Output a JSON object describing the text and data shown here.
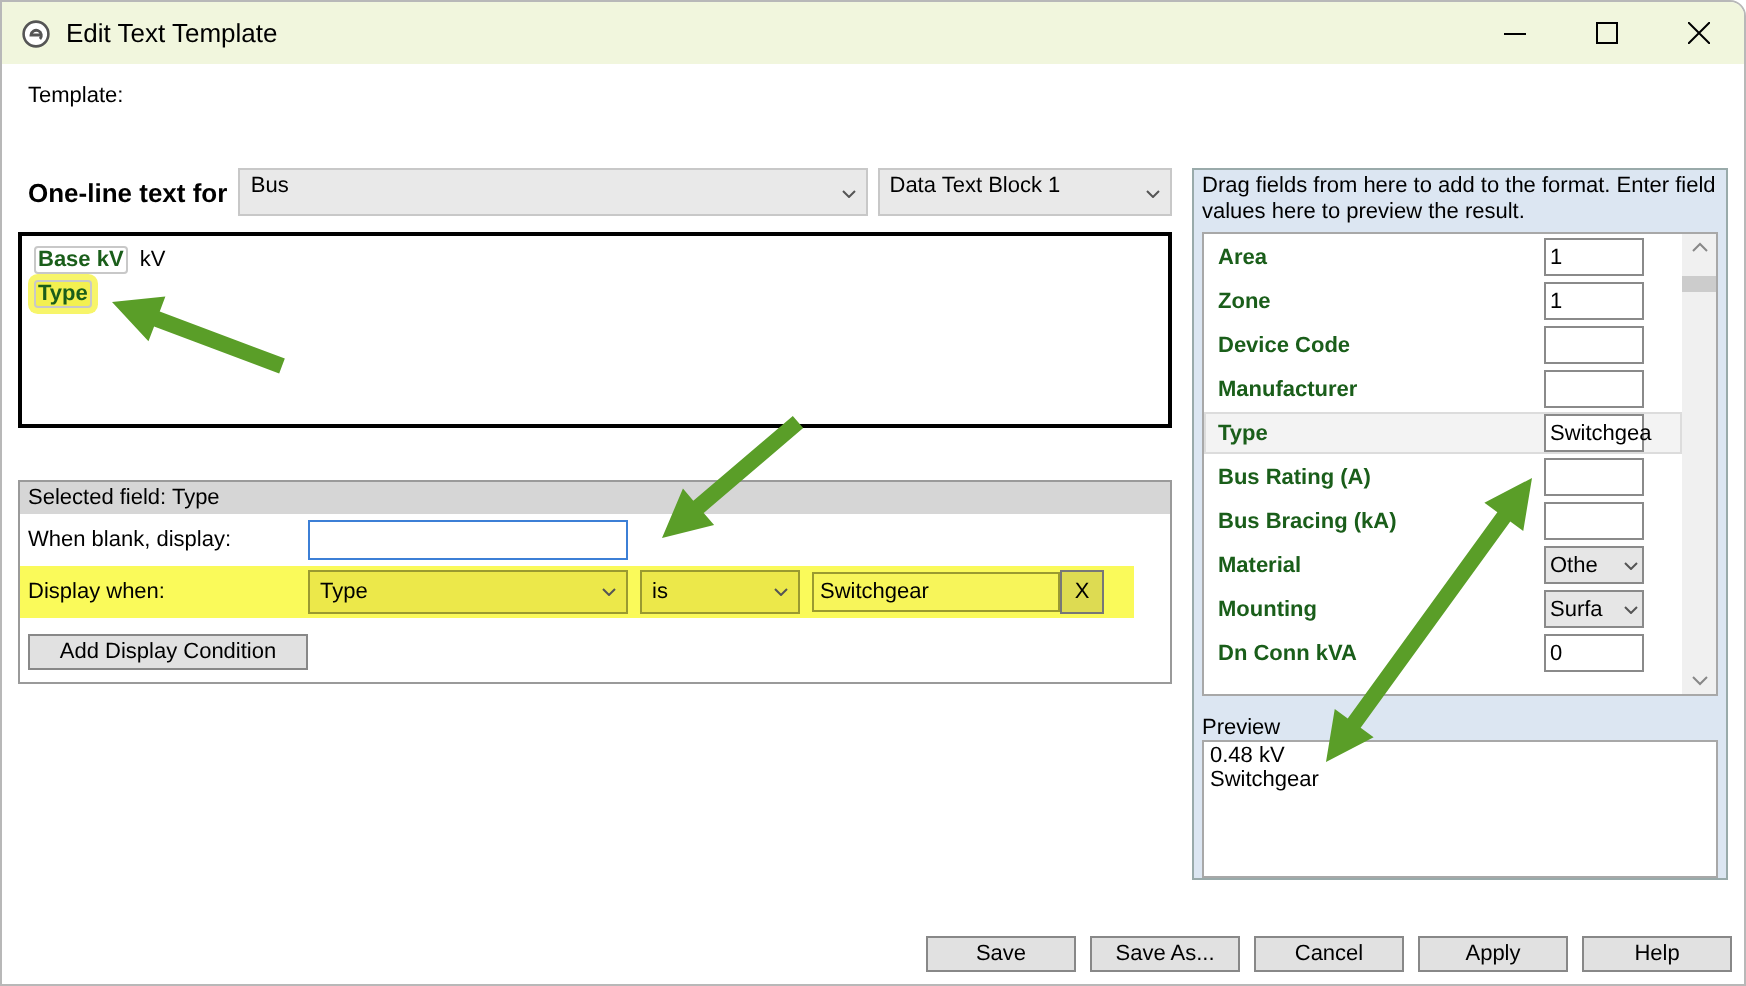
{
  "window": {
    "title": "Edit Text Template"
  },
  "template_label": "Template:",
  "one_line": {
    "label": "One-line text for",
    "element": "Bus",
    "block": "Data Text Block 1"
  },
  "template": {
    "lines": [
      [
        {
          "kind": "field",
          "text": "Base kV",
          "highlighted": false
        },
        {
          "kind": "text",
          "text": "kV"
        }
      ],
      [
        {
          "kind": "field",
          "text": "Type",
          "highlighted": true
        }
      ]
    ]
  },
  "selected_field": {
    "title": "Selected field: Type",
    "when_blank_label": "When blank, display:",
    "display_when": {
      "label": "Display when:",
      "field": "Type",
      "operator": "is",
      "value": "Switchgear",
      "remove": "X",
      "highlighted": true
    },
    "add_button": "Add Display Condition"
  },
  "fields_panel": {
    "hint": "Drag fields from here to add to the format.  Enter field values here to preview the result.",
    "fields": [
      {
        "label": "Area",
        "kind": "text",
        "value": "1",
        "selected": false
      },
      {
        "label": "Zone",
        "kind": "text",
        "value": "1",
        "selected": false
      },
      {
        "label": "Device Code",
        "kind": "text",
        "selected": false
      },
      {
        "label": "Manufacturer",
        "kind": "text",
        "selected": false
      },
      {
        "label": "Type",
        "kind": "text",
        "value": "Switchgea",
        "selected": true
      },
      {
        "label": "Bus Rating (A)",
        "kind": "text",
        "selected": false
      },
      {
        "label": "Bus Bracing (kA)",
        "kind": "text",
        "selected": false
      },
      {
        "label": "Material",
        "kind": "select",
        "value": "Othe",
        "selected": false
      },
      {
        "label": "Mounting",
        "kind": "select",
        "value": "Surfa",
        "selected": false
      },
      {
        "label": "Dn Conn kVA",
        "kind": "text",
        "value": "0",
        "selected": false
      }
    ],
    "preview_label": "Preview",
    "preview_lines": [
      "0.48 kV",
      "Switchgear"
    ]
  },
  "buttons": [
    "Save",
    "Save As...",
    "Cancel",
    "Apply",
    "Help"
  ]
}
